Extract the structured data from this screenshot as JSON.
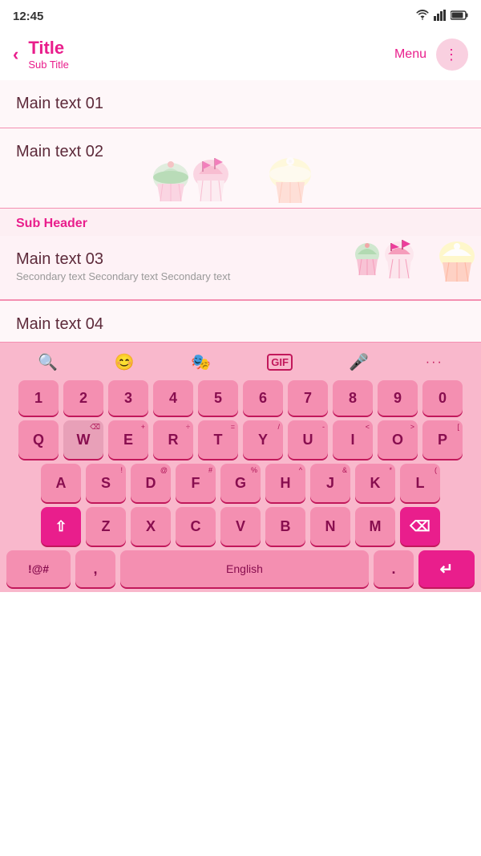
{
  "statusBar": {
    "time": "12:45",
    "wifi": "WiFi",
    "signal": "Signal",
    "battery": "Battery"
  },
  "appBar": {
    "backLabel": "‹",
    "title": "Title",
    "subtitle": "Sub Title",
    "menuLabel": "Menu",
    "moreIcon": "⋮"
  },
  "listItems": [
    {
      "id": 1,
      "main": "Main text 01",
      "secondary": ""
    },
    {
      "id": 2,
      "main": "Main text 02",
      "secondary": ""
    },
    {
      "id": 3,
      "main": "Main text 03",
      "secondary": "Secondary text Secondary text Secondary text"
    },
    {
      "id": 4,
      "main": "Main text 04",
      "secondary": ""
    }
  ],
  "subHeader": {
    "label": "Sub Header"
  },
  "keyboard": {
    "toolbar": {
      "search": "🔍",
      "emoji": "😊",
      "sticker": "🎭",
      "gif": "GIF",
      "mic": "🎤",
      "more": "···"
    },
    "rows": {
      "numbers": [
        "1",
        "2",
        "3",
        "4",
        "5",
        "6",
        "7",
        "8",
        "9",
        "0"
      ],
      "row1": [
        "Q",
        "W",
        "E",
        "R",
        "T",
        "Y",
        "U",
        "I",
        "O",
        "P"
      ],
      "row2": [
        "A",
        "S",
        "D",
        "F",
        "G",
        "H",
        "J",
        "K",
        "L"
      ],
      "row3": [
        "Z",
        "X",
        "C",
        "V",
        "B",
        "N",
        "M"
      ],
      "bottomLeft": "!@#",
      "comma": ",",
      "space": "English",
      "period": ".",
      "enter": "↵"
    },
    "subLabels": {
      "Q": "",
      "W": "⌫",
      "E": "+",
      "R": "÷",
      "T": "=",
      "Y": "/",
      "U": "-",
      "I": "<",
      "O": ">",
      "P": "[",
      "A": "",
      "S": "!",
      "D": "@",
      "F": "#",
      "G": "%",
      "H": "^",
      "J": "&",
      "K": "*",
      "L": "(",
      "Z": "",
      "X": "",
      "C": "",
      "V": "",
      "B": "",
      "N": "",
      "M": ""
    }
  }
}
